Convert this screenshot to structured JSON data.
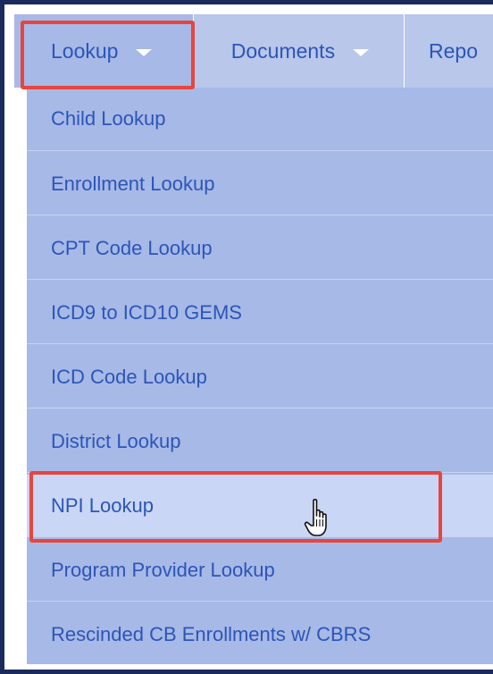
{
  "navbar": {
    "items": [
      {
        "label": "Lookup",
        "icon": "chevron-down-icon"
      },
      {
        "label": "Documents",
        "icon": "chevron-down-icon"
      },
      {
        "label": "Repo"
      }
    ]
  },
  "lookup_menu": {
    "items": [
      {
        "label": "Child Lookup"
      },
      {
        "label": "Enrollment Lookup"
      },
      {
        "label": "CPT Code Lookup"
      },
      {
        "label": "ICD9 to ICD10 GEMS"
      },
      {
        "label": "ICD Code Lookup"
      },
      {
        "label": "District Lookup"
      },
      {
        "label": "NPI Lookup",
        "state": "hover"
      },
      {
        "label": "Program Provider Lookup"
      },
      {
        "label": "Rescinded CB Enrollments w/ CBRS"
      }
    ]
  },
  "highlight_color": "#e8453f",
  "cursor_icon": "hand-pointer-icon"
}
